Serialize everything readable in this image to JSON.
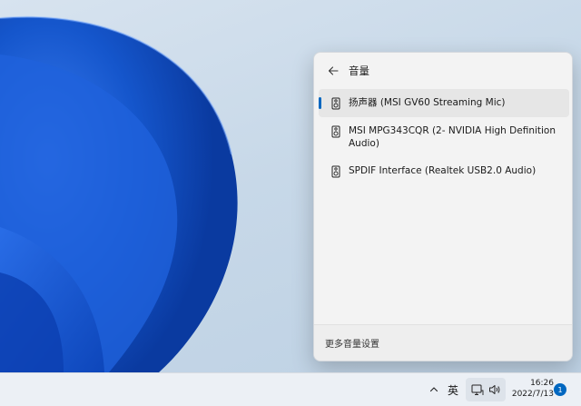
{
  "flyout": {
    "title": "音量",
    "back_icon": "back-arrow-icon",
    "devices": [
      {
        "label": "扬声器 (MSI GV60 Streaming Mic)",
        "selected": true,
        "icon": "speaker-icon"
      },
      {
        "label": "MSI MPG343CQR (2- NVIDIA High Definition Audio)",
        "selected": false,
        "icon": "speaker-icon"
      },
      {
        "label": "SPDIF Interface (Realtek USB2.0 Audio)",
        "selected": false,
        "icon": "speaker-icon"
      }
    ],
    "footer_link": "更多音量设置"
  },
  "taskbar": {
    "chevron_icon": "chevron-up-icon",
    "ime": "英",
    "network_icon": "network-monitor-icon",
    "volume_icon": "volume-icon",
    "time": "16:26",
    "date": "2022/7/13",
    "notification_count": "1"
  },
  "colors": {
    "accent": "#0067c0",
    "wallpaper_blue": "#1a5fd0"
  }
}
